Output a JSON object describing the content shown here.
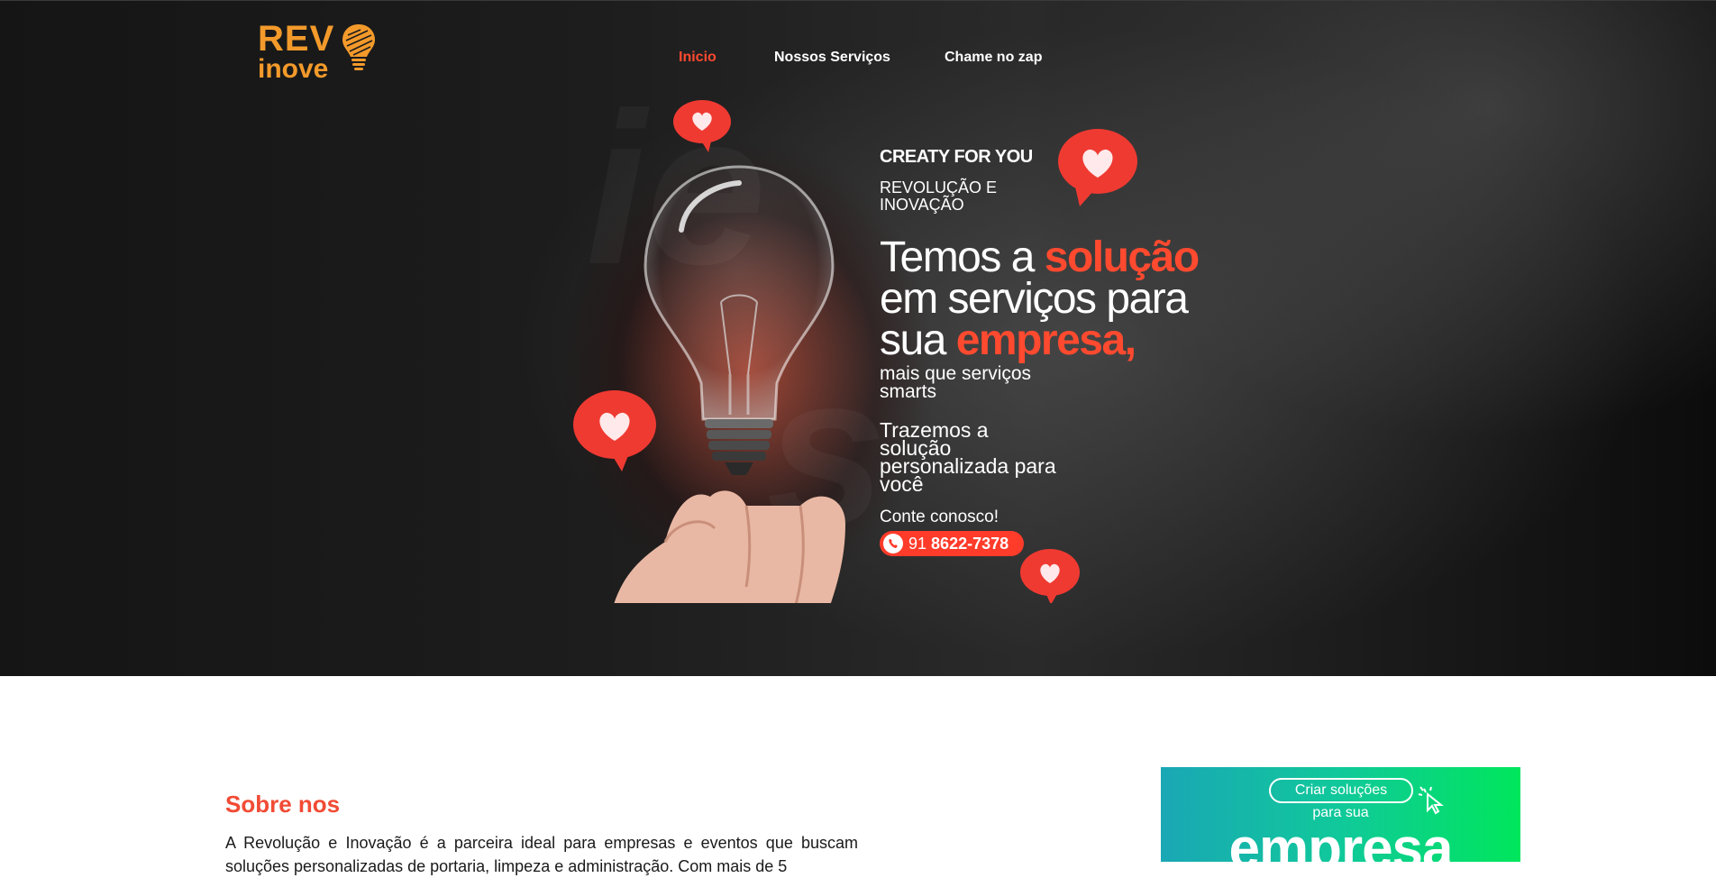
{
  "logo": {
    "line1": "REV",
    "line2": "inove",
    "color": "#f39a2b"
  },
  "nav": {
    "items": [
      {
        "label": "Inicio",
        "active": true
      },
      {
        "label": "Nossos Serviços",
        "active": false
      },
      {
        "label": "Chame no zap",
        "active": false
      }
    ],
    "active_color": "#ff4a2f"
  },
  "banner": {
    "brand": "CREATY FOR YOU",
    "tagline": "REVOLUÇÃO E INOVAÇÃO",
    "headline_part1": "Temos a ",
    "headline_hl1": "solução",
    "headline_part2": "em  serviços para sua ",
    "headline_hl2": "empresa,",
    "sub1": "mais que serviços smarts",
    "sub2": "Trazemos a solução personalizada para você",
    "contact_label": "Conte conosco!",
    "phone_prefix": "91",
    "phone_number": "8622-7378",
    "accent": "#ff3b2a"
  },
  "about": {
    "title": "Sobre nos",
    "text": "A Revolução e Inovação é a parceira ideal para empresas e eventos que buscam soluções personalizadas de portaria, limpeza e administração. Com mais de 5"
  },
  "promo": {
    "pill": "Criar soluções",
    "sub": "para sua",
    "big": "empresa"
  }
}
